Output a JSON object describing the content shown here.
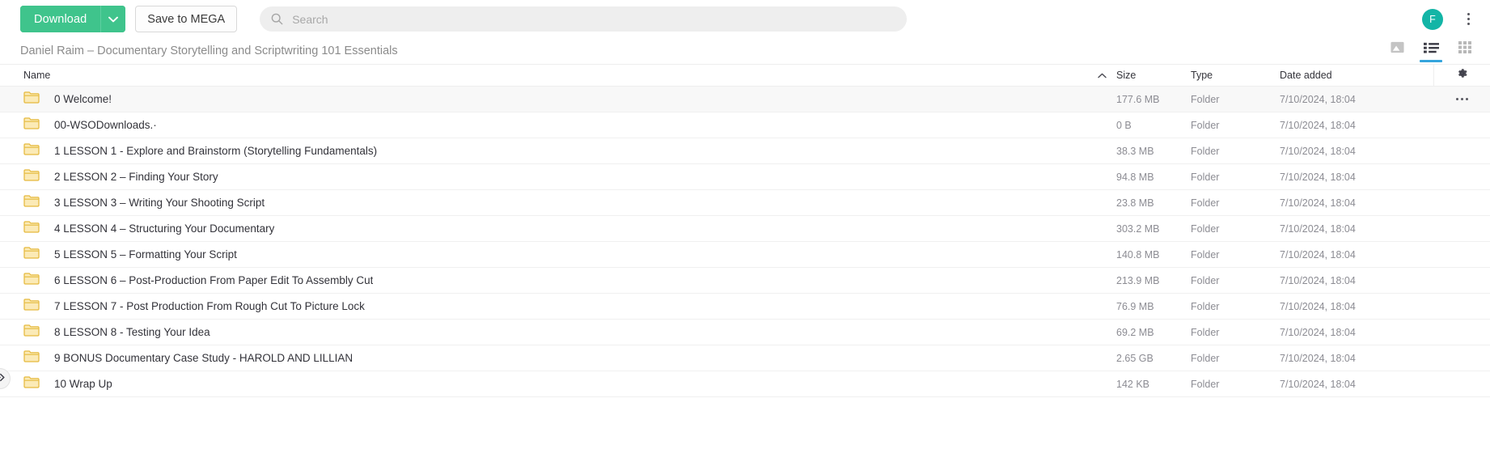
{
  "toolbar": {
    "download_label": "Download",
    "download_caret_icon": "chevron-down-icon",
    "save_to_mega_label": "Save to MEGA",
    "search_placeholder": "Search",
    "search_value": "",
    "search_icon": "search-icon",
    "avatar_initial": "F",
    "overflow_icon": "vertical-dots-icon",
    "accent_green": "#3fc48c",
    "avatar_color": "#13b5a6"
  },
  "breadcrumb": {
    "path": "Daniel Raim – Documentary Storytelling and Scriptwriting 101 Essentials"
  },
  "view_modes": {
    "active": "list",
    "items": [
      {
        "id": "thumbnail",
        "icon": "image-thumbnail-icon",
        "active": false
      },
      {
        "id": "list",
        "icon": "list-view-icon",
        "active": true
      },
      {
        "id": "grid",
        "icon": "grid-view-icon",
        "active": false
      }
    ],
    "active_underline_color": "#35a5dd"
  },
  "sidebar": {
    "expand_icon": "double-chevron-right-icon"
  },
  "table": {
    "columns": {
      "name": "Name",
      "size": "Size",
      "type": "Type",
      "date_added": "Date added"
    },
    "sort": {
      "column": "Name",
      "direction": "ascending",
      "icon": "caret-up-icon"
    },
    "settings_icon": "gear-icon",
    "row_menu_icon": "horizontal-dots-icon",
    "rows": [
      {
        "icon": "folder-icon",
        "name": "0 Welcome!",
        "size": "177.6 MB",
        "type": "Folder",
        "date": "7/10/2024, 18:04",
        "hovered": true
      },
      {
        "icon": "folder-icon",
        "name": "00-WSODownloads.·",
        "size": "0 B",
        "type": "Folder",
        "date": "7/10/2024, 18:04",
        "hovered": false
      },
      {
        "icon": "folder-icon",
        "name": "1 LESSON 1 - Explore and Brainstorm (Storytelling Fundamentals)",
        "size": "38.3 MB",
        "type": "Folder",
        "date": "7/10/2024, 18:04",
        "hovered": false
      },
      {
        "icon": "folder-icon",
        "name": "2 LESSON 2 – Finding Your Story",
        "size": "94.8 MB",
        "type": "Folder",
        "date": "7/10/2024, 18:04",
        "hovered": false
      },
      {
        "icon": "folder-icon",
        "name": "3 LESSON 3 – Writing Your Shooting Script",
        "size": "23.8 MB",
        "type": "Folder",
        "date": "7/10/2024, 18:04",
        "hovered": false
      },
      {
        "icon": "folder-icon",
        "name": "4 LESSON 4 – Structuring Your Documentary",
        "size": "303.2 MB",
        "type": "Folder",
        "date": "7/10/2024, 18:04",
        "hovered": false
      },
      {
        "icon": "folder-icon",
        "name": "5 LESSON 5 – Formatting Your Script",
        "size": "140.8 MB",
        "type": "Folder",
        "date": "7/10/2024, 18:04",
        "hovered": false
      },
      {
        "icon": "folder-icon",
        "name": "6 LESSON 6 – Post-Production From Paper Edit To Assembly Cut",
        "size": "213.9 MB",
        "type": "Folder",
        "date": "7/10/2024, 18:04",
        "hovered": false
      },
      {
        "icon": "folder-icon",
        "name": "7 LESSON 7 - Post Production From Rough Cut To Picture Lock",
        "size": "76.9 MB",
        "type": "Folder",
        "date": "7/10/2024, 18:04",
        "hovered": false
      },
      {
        "icon": "folder-icon",
        "name": "8 LESSON 8 - Testing Your Idea",
        "size": "69.2 MB",
        "type": "Folder",
        "date": "7/10/2024, 18:04",
        "hovered": false
      },
      {
        "icon": "folder-icon",
        "name": "9 BONUS Documentary Case Study - HAROLD AND LILLIAN",
        "size": "2.65 GB",
        "type": "Folder",
        "date": "7/10/2024, 18:04",
        "hovered": false
      },
      {
        "icon": "folder-icon",
        "name": "10 Wrap Up",
        "size": "142 KB",
        "type": "Folder",
        "date": "7/10/2024, 18:04",
        "hovered": false
      }
    ]
  }
}
